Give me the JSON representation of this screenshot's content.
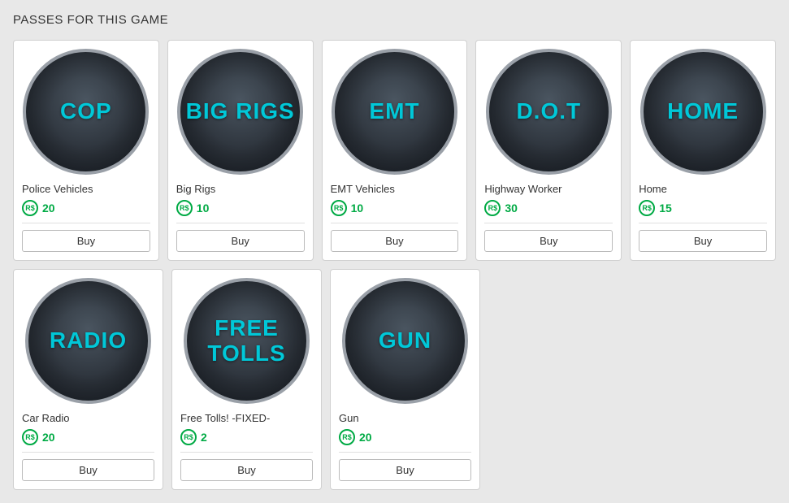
{
  "title": "PASSES FOR THIS GAME",
  "passes": [
    {
      "id": "cop",
      "icon_text": "COP",
      "name": "Police Vehicles",
      "price": 20,
      "buy_label": "Buy"
    },
    {
      "id": "big-rigs",
      "icon_text": "BIG RIGS",
      "name": "Big Rigs",
      "price": 10,
      "buy_label": "Buy"
    },
    {
      "id": "emt",
      "icon_text": "EMT",
      "name": "EMT Vehicles",
      "price": 10,
      "buy_label": "Buy"
    },
    {
      "id": "dot",
      "icon_text": "D.O.T",
      "name": "Highway Worker",
      "price": 30,
      "buy_label": "Buy"
    },
    {
      "id": "home",
      "icon_text": "HOME",
      "name": "Home",
      "price": 15,
      "buy_label": "Buy"
    },
    {
      "id": "radio",
      "icon_text": "RADIO",
      "name": "Car Radio",
      "price": 20,
      "buy_label": "Buy"
    },
    {
      "id": "free-tolls",
      "icon_text": "FREE TOLLS",
      "name": "Free Tolls! -FIXED-",
      "price": 2,
      "buy_label": "Buy"
    },
    {
      "id": "gun",
      "icon_text": "GUN",
      "name": "Gun",
      "price": 20,
      "buy_label": "Buy"
    }
  ],
  "robux_symbol": "R$"
}
